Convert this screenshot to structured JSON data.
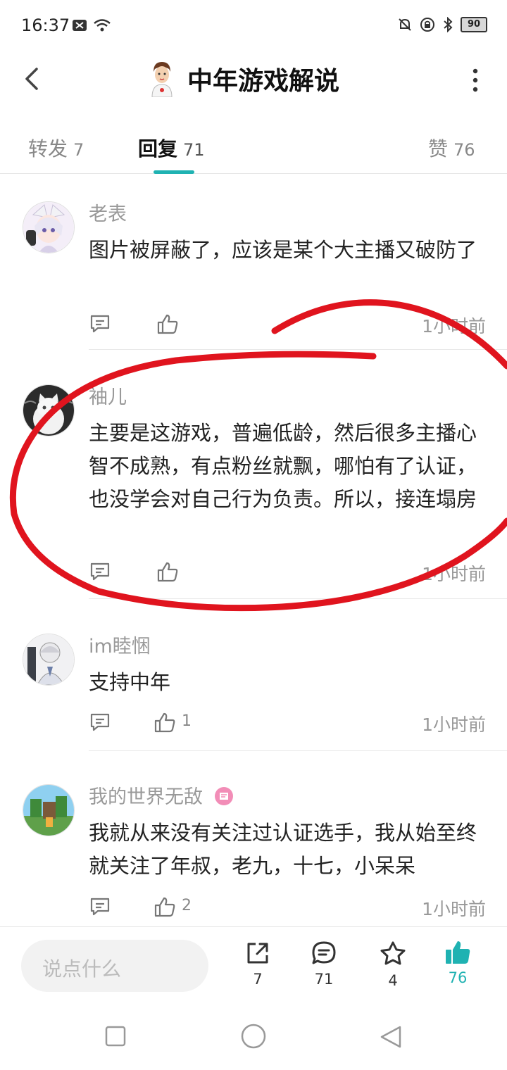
{
  "status_bar": {
    "time": "16:37",
    "battery": "90"
  },
  "header": {
    "title": "中年游戏解说"
  },
  "tabs": [
    {
      "label": "转发",
      "count": "7"
    },
    {
      "label": "回复",
      "count": "71"
    },
    {
      "label": "赞",
      "count": "76"
    }
  ],
  "comments": [
    {
      "name": "老表",
      "text": "图片被屏蔽了，应该是某个大主播又破防了",
      "likes": "",
      "time": "1小时前"
    },
    {
      "name": "袖儿",
      "text": "主要是这游戏，普遍低龄，然后很多主播心智不成熟，有点粉丝就飘，哪怕有了认证，也没学会对自己行为负责。所以，接连塌房",
      "likes": "",
      "time": "1小时前"
    },
    {
      "name": "im睦悃",
      "text": "支持中年",
      "likes": "1",
      "time": "1小时前"
    },
    {
      "name": "我的世界无敌",
      "text": "我就从来没有关注过认证选手，我从始至终就关注了年叔，老九，十七，小呆呆",
      "likes": "2",
      "time": "1小时前"
    }
  ],
  "bottom_bar": {
    "input_placeholder": "说点什么",
    "share_count": "7",
    "comment_count": "71",
    "favorite_count": "4",
    "like_count": "76"
  },
  "colors": {
    "accent": "#1fb2b2",
    "annotation": "#e0141e"
  }
}
